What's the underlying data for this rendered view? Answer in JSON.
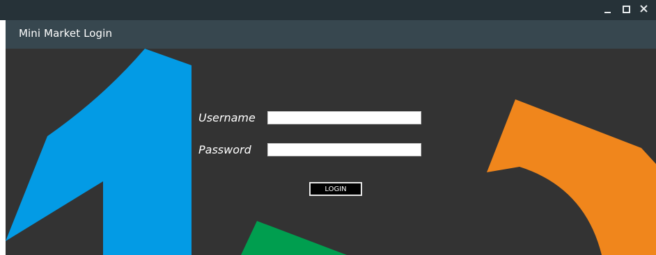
{
  "window": {
    "controls": {
      "minimize": "minimize-icon",
      "maximize": "maximize-icon",
      "close": "close-icon"
    }
  },
  "header": {
    "title": "Mini Market Login"
  },
  "form": {
    "username_label": "Username",
    "username_value": "",
    "password_label": "Password",
    "password_value": "",
    "login_label": "LOGIN"
  },
  "colors": {
    "titlebar": "#263238",
    "header": "#37474f",
    "background": "#333333",
    "blue": "#039be5",
    "orange": "#f0861c",
    "green": "#009e4f"
  }
}
